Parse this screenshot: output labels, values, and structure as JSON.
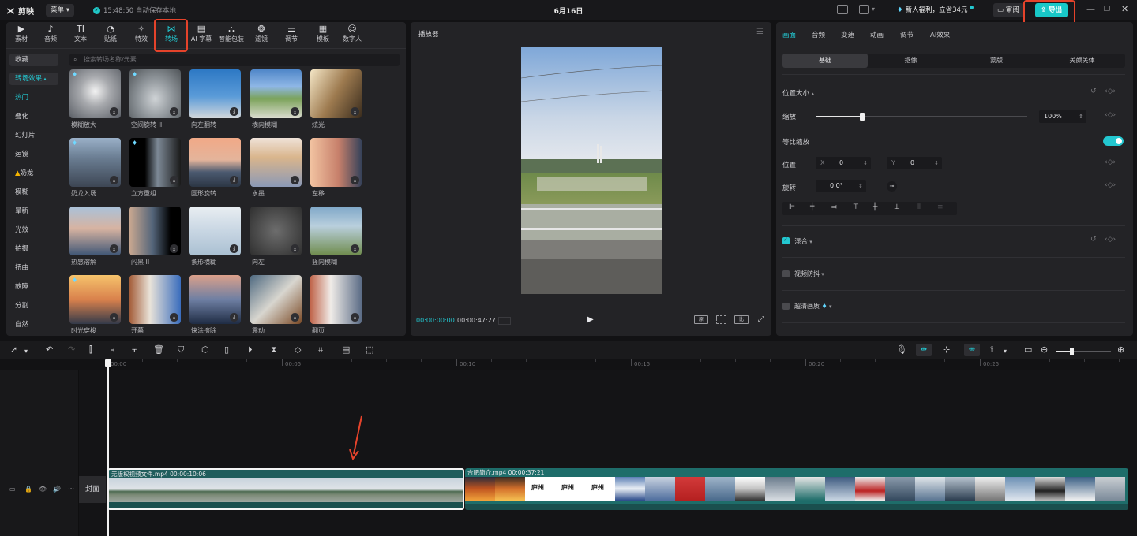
{
  "titlebar": {
    "app_name": "剪映",
    "menu_label": "菜单",
    "save_status": "15:48:50 自动保存本地",
    "project_title": "6月16日",
    "promo_text": "新人福利，立省34元",
    "review_label": "审阅",
    "export_label": "导出"
  },
  "library": {
    "tools": [
      {
        "label": "素材",
        "icon": "media-icon"
      },
      {
        "label": "音频",
        "icon": "audio-icon"
      },
      {
        "label": "文本",
        "icon": "text-icon"
      },
      {
        "label": "贴纸",
        "icon": "sticker-icon"
      },
      {
        "label": "特效",
        "icon": "effects-icon"
      },
      {
        "label": "转场",
        "icon": "transition-icon"
      },
      {
        "label": "AI 字幕",
        "icon": "ai-caption-icon"
      },
      {
        "label": "智能包装",
        "icon": "smart-pack-icon"
      },
      {
        "label": "滤镜",
        "icon": "filter-icon"
      },
      {
        "label": "调节",
        "icon": "adjust-icon"
      },
      {
        "label": "模板",
        "icon": "template-icon"
      },
      {
        "label": "数字人",
        "icon": "digital-human-icon"
      }
    ],
    "active_tool": "转场",
    "categories": [
      "收藏",
      "转场效果",
      "热门",
      "叠化",
      "幻灯片",
      "运镜",
      "奶龙",
      "模糊",
      "晕新",
      "光效",
      "拍摄",
      "扭曲",
      "故障",
      "分割",
      "自然"
    ],
    "search_placeholder": "搜索转场名称/元素",
    "items": [
      "模糊放大",
      "空间旋转 II",
      "向左翻转",
      "横向模糊",
      "炫光",
      "奶龙入场",
      "立方重组",
      "圆形旋转",
      "水墨",
      "左移",
      "热感溶解",
      "闪黑 II",
      "条形横糊",
      "向左",
      "竖向模糊",
      "时光穿梭",
      "开幕",
      "快涂擦除",
      "震动",
      "翻页"
    ]
  },
  "player": {
    "title": "播放器",
    "current_time": "00:00:00:00",
    "duration": "00:00:47:27"
  },
  "inspector": {
    "tabs": [
      "画面",
      "音频",
      "变速",
      "动画",
      "调节",
      "AI效果"
    ],
    "subtabs": [
      "基础",
      "抠像",
      "蒙版",
      "美颜美体"
    ],
    "section_position": "位置大小",
    "scale_label": "缩放",
    "scale_value": "100%",
    "scale_fraction": 0.22,
    "uniform_scale_label": "等比缩放",
    "uniform_scale_on": true,
    "position_label": "位置",
    "x_label": "X",
    "x_value": "0",
    "y_label": "Y",
    "y_value": "0",
    "rotate_label": "旋转",
    "rotate_value": "0.0°",
    "blend_label": "混合",
    "blend_checked": true,
    "stabilize_label": "视频防抖",
    "stabilize_checked": false,
    "hd_label": "超清画质",
    "hd_checked": false
  },
  "timeline": {
    "ruler": [
      "00:00",
      "00:05",
      "00:10",
      "00:15",
      "00:20",
      "00:25"
    ],
    "cover_label": "封面",
    "clips": [
      {
        "name": "无版权视频文件.mp4",
        "duration": "00:00:10:06"
      },
      {
        "name": "合肥简介.mp4",
        "duration": "00:00:37:21"
      }
    ],
    "clip2_caption": "庐州"
  },
  "colors": {
    "accent": "#23c7d0",
    "highlight_box": "#e5432b",
    "clip": "#1f5d5c"
  }
}
